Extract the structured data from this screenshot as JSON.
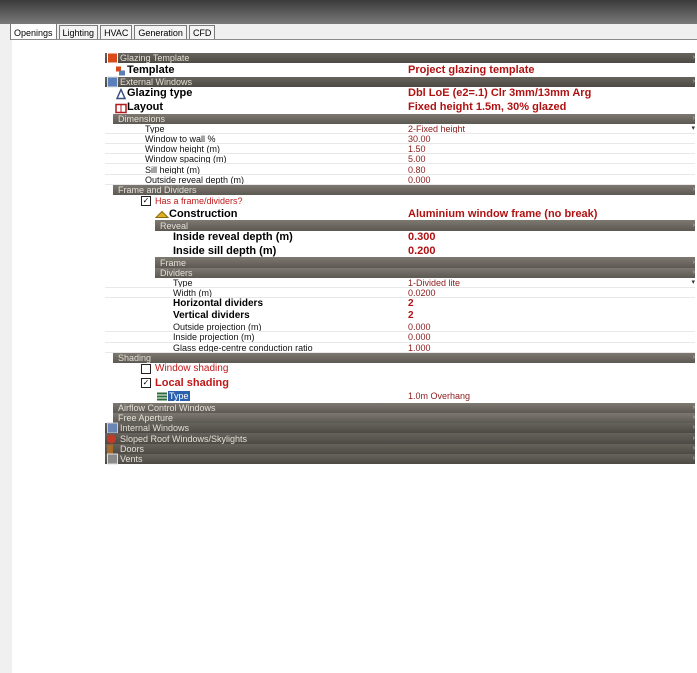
{
  "tabs": [
    "Openings",
    "Lighting",
    "HVAC",
    "Generation",
    "CFD"
  ],
  "active_tab": "Openings",
  "colors": {
    "section_bar": "#6a655e",
    "value_text": "#a01010",
    "selection": "#2a5fb0"
  },
  "rows": {
    "glazing_template": "Glazing Template",
    "template_label": "Template",
    "template_value": "Project glazing template",
    "external_windows": "External Windows",
    "glazing_type_label": "Glazing type",
    "glazing_type_value": "Dbl LoE (e2=.1) Clr 3mm/13mm Arg",
    "layout_label": "Layout",
    "layout_value": "Fixed height 1.5m, 30% glazed",
    "dimensions": "Dimensions",
    "type_label": "Type",
    "type_value": "2-Fixed height",
    "wtw_label": "Window to wall %",
    "wtw_value": "30.00",
    "wh_label": "Window height (m)",
    "wh_value": "1.50",
    "ws_label": "Window spacing (m)",
    "ws_value": "5.00",
    "sill_label": "Sill height (m)",
    "sill_value": "0.80",
    "ord_label": "Outside reveal depth (m)",
    "ord_value": "0.000",
    "frame_dividers": "Frame and Dividers",
    "has_frame_label": "Has a frame/dividers?",
    "construction_label": "Construction",
    "construction_value": "Aluminium window frame (no break)",
    "reveal": "Reveal",
    "ird_label": "Inside reveal depth (m)",
    "ird_value": "0.300",
    "isd_label": "Inside sill depth (m)",
    "isd_value": "0.200",
    "frame": "Frame",
    "dividers": "Dividers",
    "div_type_label": "Type",
    "div_type_value": "1-Divided lite",
    "width_label": "Width (m)",
    "width_value": "0.0200",
    "hdiv_label": "Horizontal dividers",
    "hdiv_value": "2",
    "vdiv_label": "Vertical dividers",
    "vdiv_value": "2",
    "op_label": "Outside projection (m)",
    "op_value": "0.000",
    "ip_label": "Inside projection (m)",
    "ip_value": "0.000",
    "gecr_label": "Glass edge-centre conduction ratio",
    "gecr_value": "1.000",
    "shading": "Shading",
    "window_shading_label": "Window shading",
    "local_shading_label": "Local shading",
    "ls_type_label": "Type",
    "ls_type_value": "1.0m Overhang",
    "airflow": "Airflow Control Windows",
    "free_aperture": "Free Aperture",
    "internal_windows": "Internal Windows",
    "sloped_roof": "Sloped Roof Windows/Skylights",
    "doors": "Doors",
    "vents": "Vents"
  }
}
